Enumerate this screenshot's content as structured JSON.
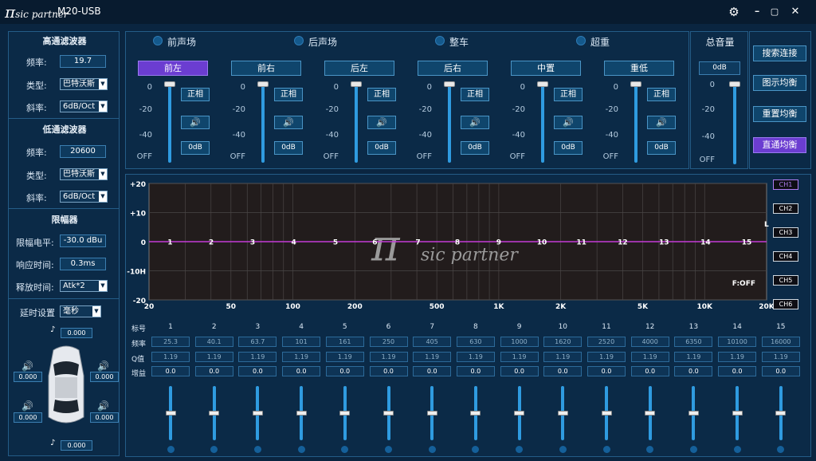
{
  "app": {
    "logo_mark": "π",
    "logo_text": "sic partner",
    "title": "M20-USB"
  },
  "window": {
    "settings_icon": "⚙",
    "min": "━",
    "max": "▢",
    "close": "✕"
  },
  "hpf": {
    "title": "高通滤波器",
    "freq_label": "频率:",
    "freq": "19.7",
    "type_label": "类型:",
    "type": "巴特沃斯",
    "slope_label": "斜率:",
    "slope": "6dB/Oct"
  },
  "lpf": {
    "title": "低通滤波器",
    "freq_label": "频率:",
    "freq": "20600",
    "type_label": "类型:",
    "type": "巴特沃斯",
    "slope_label": "斜率:",
    "slope": "6dB/Oct"
  },
  "limiter": {
    "title": "限幅器",
    "level_label": "限幅电平:",
    "level": "-30.0 dBu",
    "response_label": "响应时间:",
    "response": "0.3ms",
    "release_label": "释放时间:",
    "release": "Atk*2"
  },
  "delay": {
    "label": "延时设置",
    "unit": "毫秒",
    "top": "0.000",
    "fl": "0.000",
    "fr": "0.000",
    "rl": "0.000",
    "rr": "0.000",
    "bottom": "0.000"
  },
  "groups": [
    "前声场",
    "后声场",
    "整车",
    "超重"
  ],
  "channels": [
    {
      "name": "前左",
      "phase": "正相",
      "gain": "0dB",
      "active": true
    },
    {
      "name": "前右",
      "phase": "正相",
      "gain": "0dB",
      "active": false
    },
    {
      "name": "后左",
      "phase": "正相",
      "gain": "0dB",
      "active": false
    },
    {
      "name": "后右",
      "phase": "正相",
      "gain": "0dB",
      "active": false
    },
    {
      "name": "中置",
      "phase": "正相",
      "gain": "0dB",
      "active": false
    },
    {
      "name": "重低",
      "phase": "正相",
      "gain": "0dB",
      "active": false
    }
  ],
  "scale": [
    "0",
    "-20",
    "-40",
    "OFF"
  ],
  "master": {
    "title": "总音量",
    "value": "0dB",
    "scale": [
      "0",
      "-20",
      "-40",
      "OFF"
    ]
  },
  "buttons": {
    "search": "搜索连接",
    "graphic": "图示均衡",
    "reset": "重置均衡",
    "bypass": "直通均衡"
  },
  "graph": {
    "y_labels": [
      "+20",
      "+10",
      "0",
      "-10H",
      "-20"
    ],
    "x_labels": [
      "20",
      "50",
      "100",
      "200",
      "500",
      "1K",
      "2K",
      "5K",
      "10K",
      "20K"
    ],
    "filter_status": "F:OFF",
    "right_marker": "L",
    "watermark_mark": "π",
    "watermark_text": "sic partner",
    "ch_labels": [
      "CH1",
      "CH2",
      "CH3",
      "CH4",
      "CH5",
      "CH6"
    ],
    "line_color": "#c33bd6"
  },
  "chart_data": {
    "type": "line",
    "x": [
      25.3,
      40.1,
      63.7,
      101,
      161,
      250,
      405,
      630,
      1000,
      1620,
      2520,
      4000,
      6350,
      10100,
      16000
    ],
    "series": [
      {
        "values": [
          0,
          0,
          0,
          0,
          0,
          0,
          0,
          0,
          0,
          0,
          0,
          0,
          0,
          0,
          0
        ]
      }
    ],
    "xlim": [
      20,
      20000
    ],
    "ylim": [
      -20,
      20
    ],
    "x_scale": "log"
  },
  "eq": {
    "row_labels": [
      "标号",
      "频率",
      "Q值",
      "增益"
    ],
    "bands": [
      {
        "no": "1",
        "freq": "25.3",
        "q": "1.19",
        "gain": "0.0"
      },
      {
        "no": "2",
        "freq": "40.1",
        "q": "1.19",
        "gain": "0.0"
      },
      {
        "no": "3",
        "freq": "63.7",
        "q": "1.19",
        "gain": "0.0"
      },
      {
        "no": "4",
        "freq": "101",
        "q": "1.19",
        "gain": "0.0"
      },
      {
        "no": "5",
        "freq": "161",
        "q": "1.19",
        "gain": "0.0"
      },
      {
        "no": "6",
        "freq": "250",
        "q": "1.19",
        "gain": "0.0"
      },
      {
        "no": "7",
        "freq": "405",
        "q": "1.19",
        "gain": "0.0"
      },
      {
        "no": "8",
        "freq": "630",
        "q": "1.19",
        "gain": "0.0"
      },
      {
        "no": "9",
        "freq": "1000",
        "q": "1.19",
        "gain": "0.0"
      },
      {
        "no": "10",
        "freq": "1620",
        "q": "1.19",
        "gain": "0.0"
      },
      {
        "no": "11",
        "freq": "2520",
        "q": "1.19",
        "gain": "0.0"
      },
      {
        "no": "12",
        "freq": "4000",
        "q": "1.19",
        "gain": "0.0"
      },
      {
        "no": "13",
        "freq": "6350",
        "q": "1.19",
        "gain": "0.0"
      },
      {
        "no": "14",
        "freq": "10100",
        "q": "1.19",
        "gain": "0.0"
      },
      {
        "no": "15",
        "freq": "16000",
        "q": "1.19",
        "gain": "0.0"
      }
    ]
  }
}
